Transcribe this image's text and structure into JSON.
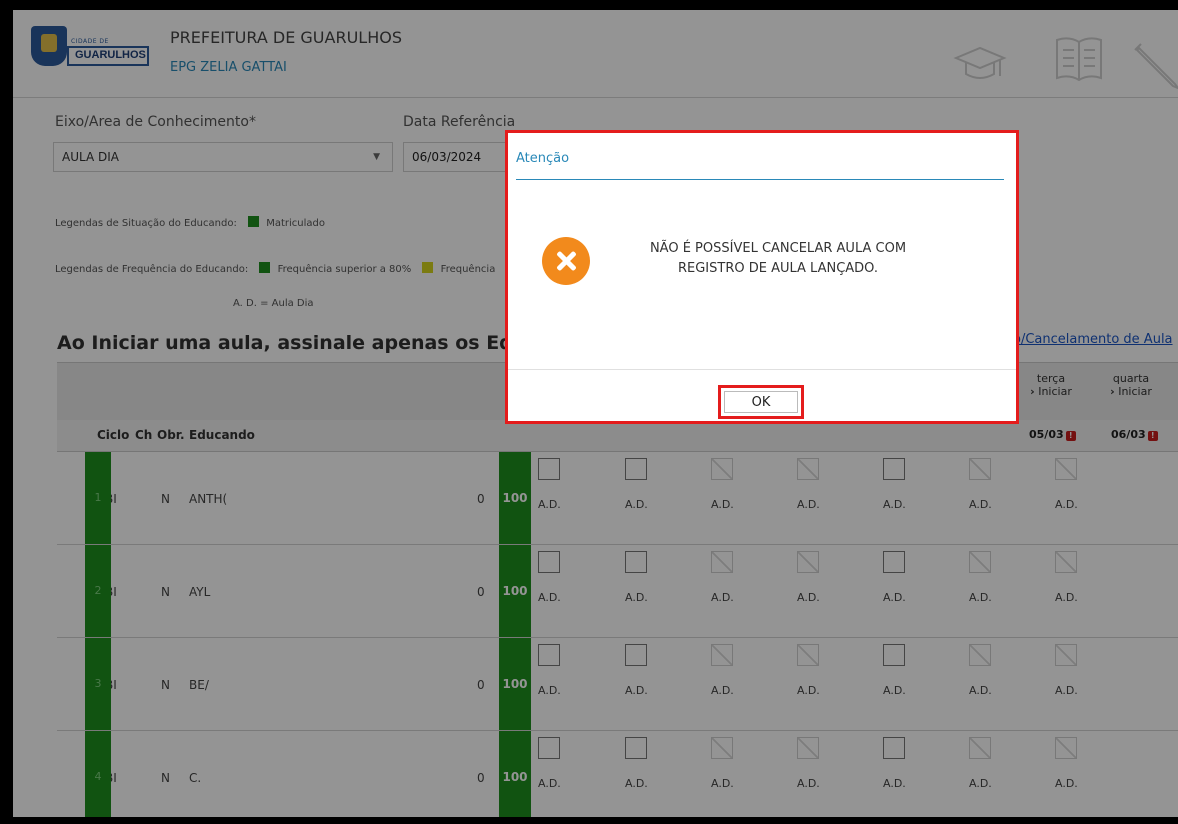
{
  "header": {
    "city_top": "CIDADE DE",
    "city_name": "GUARULHOS",
    "title": "PREFEITURA DE GUARULHOS",
    "school": "EPG ZELIA GATTAI"
  },
  "form": {
    "eixo_label": "Eixo/Area de Conhecimento*",
    "eixo_value": "AULA DIA",
    "data_label": "Data Referência",
    "data_value": "06/03/2024"
  },
  "legends": {
    "situacao_label": "Legendas de Situação do Educando:",
    "matriculado": "Matriculado",
    "frequencia_label": "Legendas de Frequência do Educando:",
    "freq_superior": "Frequência superior a 80%",
    "freq_partial": "Frequência",
    "ad_note": "A. D. = Aula Dia",
    "colors": {
      "green": "#1e8f1e",
      "yellow": "#d4d41e"
    }
  },
  "main": {
    "title": "Ao Iniciar uma aula, assinale apenas os Educandos Au",
    "cancel_link": "o/Cancelamento de Aula"
  },
  "table": {
    "headers": {
      "ciclo": "Ciclo",
      "ch": "Ch",
      "obr": "Obr.",
      "educando": "Educando"
    },
    "days": [
      {
        "weekday": "terça",
        "action": "Iniciar",
        "date": "05/03"
      },
      {
        "weekday": "quarta",
        "action": "Iniciar",
        "date": "06/03"
      }
    ],
    "ad_label": "A.D.",
    "rows": [
      {
        "ciclo": "BI",
        "ch": "1",
        "obr": "N",
        "educando": "ANTH(",
        "faltas": "0",
        "pct": "100"
      },
      {
        "ciclo": "BI",
        "ch": "2",
        "obr": "N",
        "educando": "AYL",
        "faltas": "0",
        "pct": "100"
      },
      {
        "ciclo": "BI",
        "ch": "3",
        "obr": "N",
        "educando": "BE/",
        "faltas": "0",
        "pct": "100"
      },
      {
        "ciclo": "BI",
        "ch": "4",
        "obr": "N",
        "educando": "C.",
        "faltas": "0",
        "pct": "100"
      }
    ]
  },
  "modal": {
    "title": "Atenção",
    "message_line1": "NÃO É POSSÍVEL CANCELAR AULA COM",
    "message_line2": "REGISTRO DE AULA LANÇADO.",
    "ok_label": "OK",
    "icon": "error-x-icon",
    "highlight_color": "#e41c1c"
  }
}
